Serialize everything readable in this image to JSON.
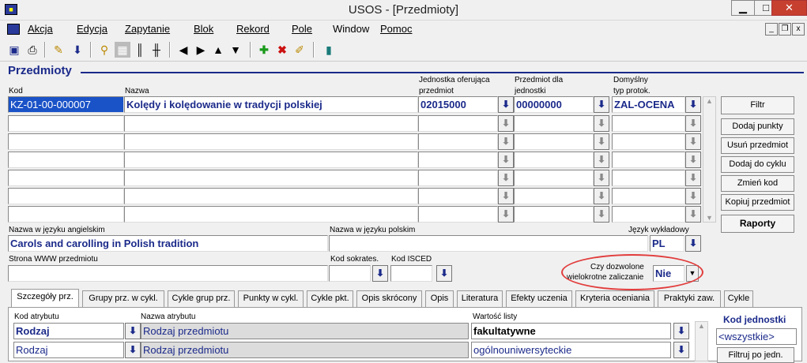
{
  "window": {
    "title": "USOS - [Przedmioty]",
    "min": "▁",
    "max": "□",
    "close": "✕"
  },
  "menu": [
    "Akcja",
    "Edycja",
    "Zapytanie",
    "Blok",
    "Rekord",
    "Pole",
    "Window",
    "Pomoc"
  ],
  "mdi": {
    "min": "_",
    "restore": "❐",
    "close": "x"
  },
  "panel_title": "Przedmioty",
  "labels": {
    "kod": "Kod",
    "nazwa": "Nazwa",
    "jedn1": "Jednostka oferująca",
    "jedn2": "przedmiot",
    "pdla1": "Przedmiot dla",
    "pdla2": "jednostki",
    "dom1": "Domyślny",
    "dom2": "typ protok.",
    "nazwa_ang": "Nazwa w języku angielskim",
    "nazwa_pl": "Nazwa w języku polskim",
    "jezyk": "Język wykładowy",
    "www": "Strona WWW  przedmiotu",
    "sokrates": "Kod sokrates.",
    "isced": "Kod ISCED",
    "wielo1": "Czy dozwolone",
    "wielo2": "wielokrotne zaliczanie"
  },
  "row1": {
    "kod": "KZ-01-00-000007",
    "nazwa": "Kolędy i kolędowanie w tradycji polskiej",
    "jedn": "02015000",
    "pdla": "00000000",
    "dom": "ZAL-OCENA"
  },
  "nazwa_ang": "Carols and carolling in Polish tradition",
  "jezyk": "PL",
  "wielo": "Nie",
  "buttons": [
    "Filtr",
    "Dodaj punkty",
    "Usuń przedmiot",
    "Dodaj do cyklu",
    "Zmień kod",
    "Kopiuj przedmiot",
    "Raporty"
  ],
  "tabs": [
    "Szczegóły prz.",
    "Grupy prz. w cykl.",
    "Cykle grup prz.",
    "Punkty w cykl.",
    "Cykle pkt.",
    "Opis skrócony",
    "Opis",
    "Literatura",
    "Efekty uczenia",
    "Kryteria oceniania",
    "Praktyki zaw.",
    "Cykle"
  ],
  "detail_labels": {
    "kod_atr": "Kod atrybutu",
    "nazwa_atr": "Nazwa atrybutu",
    "wartosc": "Wartość listy",
    "kod_jedn": "Kod jednostki"
  },
  "detail_rows": [
    {
      "kod": "Rodzaj",
      "nazwa": "Rodzaj przedmiotu",
      "wartosc": "fakultatywne"
    },
    {
      "kod": "Rodzaj",
      "nazwa": "Rodzaj przedmiotu",
      "wartosc": "ogólnouniwersyteckie"
    }
  ],
  "kod_jedn_value": "<wszystkie>",
  "filtruj_btn": "Filtruj po jedn.",
  "colors": {
    "accent": "#1b2a8a",
    "selection": "#1a52c7",
    "highlight": "#e23c3c"
  }
}
